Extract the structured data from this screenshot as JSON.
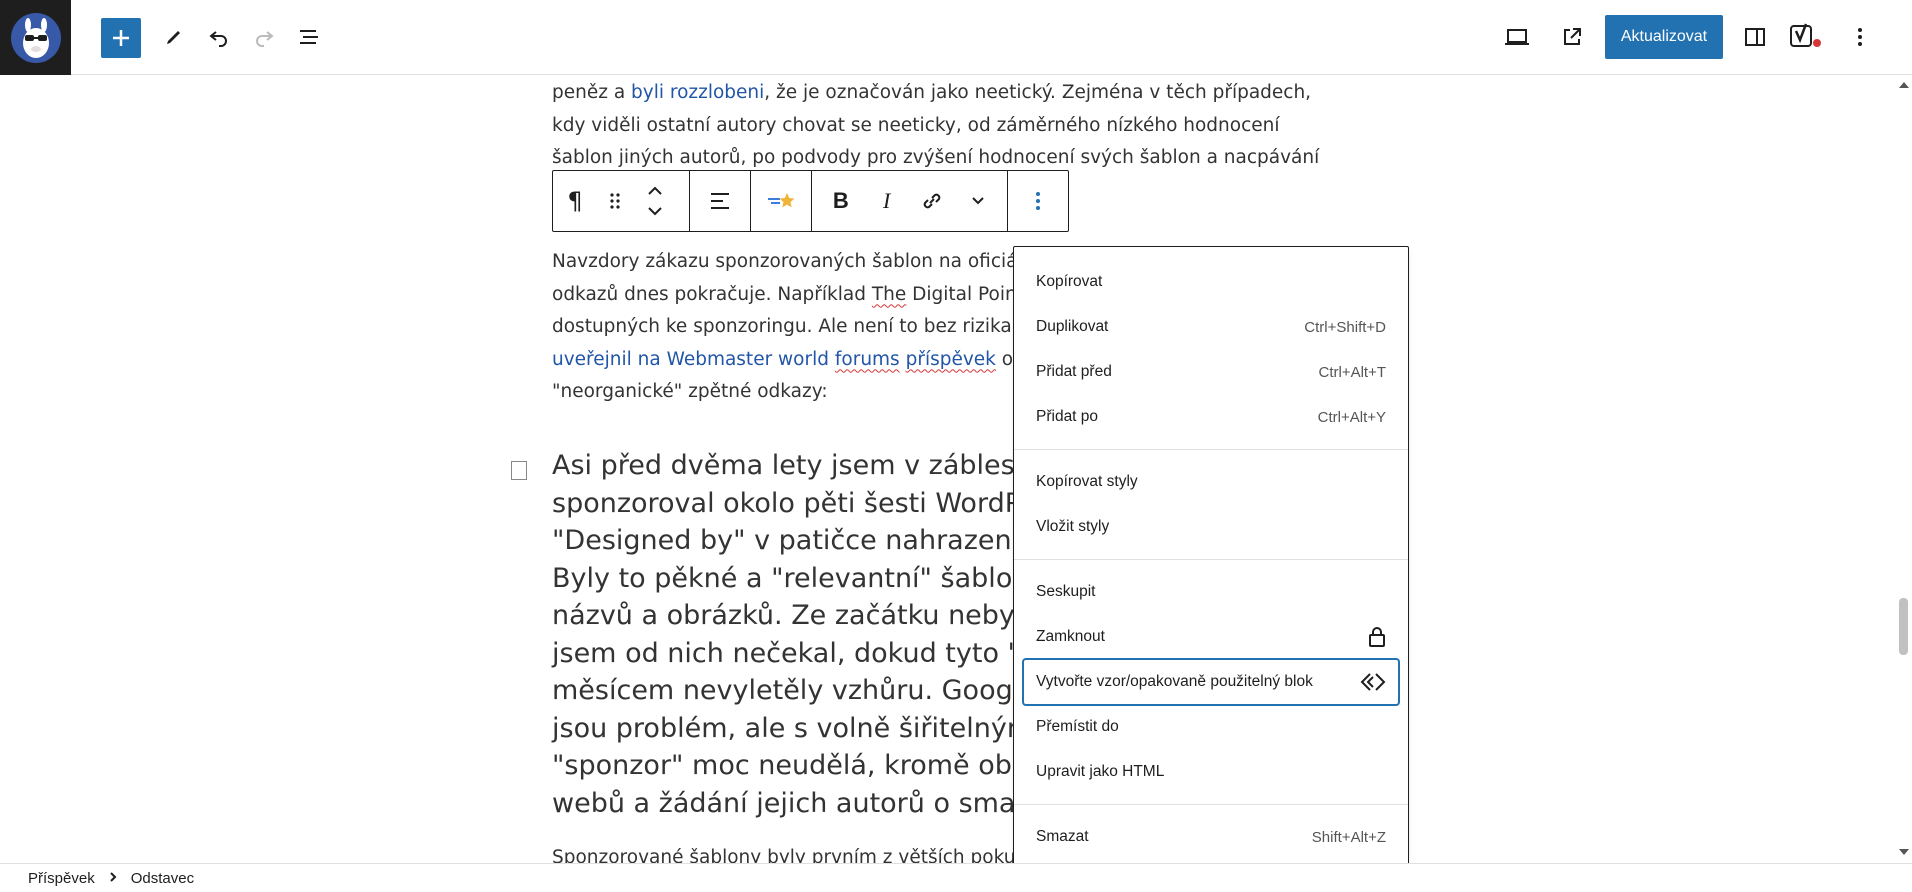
{
  "toolbar": {
    "update_label": "Aktualizovat",
    "add_icon": "plus-icon",
    "edit_icon": "pencil-icon",
    "undo_icon": "undo-icon",
    "redo_icon": "redo-icon",
    "list_view_icon": "list-view-icon",
    "preview_icon": "desktop-preview-icon",
    "view_post_icon": "external-link-icon",
    "settings_icon": "sidebar-toggle-icon",
    "yoast_icon": "yoast-icon",
    "options_icon": "more-vertical-icon",
    "accent_color": "#2271b1"
  },
  "content": {
    "top_para": {
      "line1_before": "peněz a ",
      "line1_link": "byli rozzlobeni",
      "line1_after": ", že je označován jako neetický. Zejména v těch případech,",
      "line2": "kdy viděli ostatní autory chovat se neeticky, od záměrného nízkého hodnocení",
      "line3": "šablon jiných autorů, po podvody pro zvýšení hodnocení svých šablon a nacpávání"
    },
    "para2": {
      "line1": "Navzdory zákazu sponzorovaných šablon na oficiá",
      "line2_before": "odkazů dnes pokračuje. Například ",
      "line2_squiggle": "The",
      "line2_after": " Digital Poin",
      "line3": "dostupných ke sponzoringu. Ale není to bez rizika",
      "line4_link1": "uveřejnil na Webmaster world ",
      "line4_link2": "forums",
      "line4_link3": " ",
      "line4_link4": "příspěvek",
      "line4_after": " o",
      "line5": "\"neorganické\" zpětné odkazy:"
    },
    "quote_lines": [
      "Asi před dvěma lety jsem v zábleskus",
      "sponzoroval okolo pěti šesti WordPr",
      "\"Designed by\" v patičce nahrazen od",
      "Byly to pěkné a \"relevantní\" šablony,",
      "názvů a obrázků. Ze začátku nebyly n",
      "jsem od nich nečekal, dokud tyto \"ne",
      "měsícem nevyletěly vzhůru. Google s",
      "jsou problém, ale s volně šiřitelnými",
      "\"sponzor\" moc neudělá, kromě obep",
      "webů a žádání jejich autorů o smazá"
    ],
    "bottom_para": "Sponzorované šablony byly prvním z větších poku"
  },
  "block_toolbar": {
    "paragraph_icon": "¶",
    "drag_icon": "drag-handle-icon",
    "move_icon": "move-up-down-icon",
    "align_icon": "align-left-icon",
    "ai_icon": "ai-star-icon",
    "bold_label": "B",
    "italic_label": "I",
    "link_icon": "link-icon",
    "more_icon": "chevron-down-icon",
    "options_icon": "more-vertical-icon"
  },
  "menu": {
    "items": [
      {
        "label": "Kopírovat",
        "shortcut": ""
      },
      {
        "label": "Duplikovat",
        "shortcut": "Ctrl+Shift+D"
      },
      {
        "label": "Přidat před",
        "shortcut": "Ctrl+Alt+T"
      },
      {
        "label": "Přidat po",
        "shortcut": "Ctrl+Alt+Y"
      },
      {
        "label": "Kopírovat styly",
        "shortcut": ""
      },
      {
        "label": "Vložit styly",
        "shortcut": ""
      },
      {
        "label": "Seskupit",
        "shortcut": ""
      },
      {
        "label": "Zamknout",
        "shortcut": ""
      },
      {
        "label": "Vytvořte vzor/opakovaně použitelný blok",
        "shortcut": ""
      },
      {
        "label": "Přemístit do",
        "shortcut": ""
      },
      {
        "label": "Upravit jako HTML",
        "shortcut": ""
      },
      {
        "label": "Smazat",
        "shortcut": "Shift+Alt+Z"
      }
    ]
  },
  "breadcrumb": {
    "items": [
      "Příspěvek",
      "Odstavec"
    ]
  }
}
